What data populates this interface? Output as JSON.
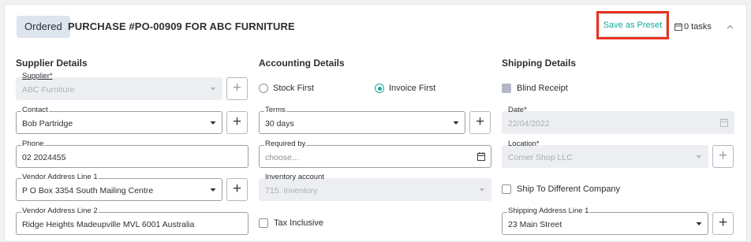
{
  "header": {
    "status_badge": "Ordered",
    "title": "PURCHASE #PO-00909 FOR ABC FURNITURE",
    "save_preset_label": "Save as Preset",
    "tasks_label": "0 tasks"
  },
  "supplier": {
    "heading": "Supplier Details",
    "supplier_label": "Supplier*",
    "supplier_value": "ABC Furniture",
    "contact_label": "Contact",
    "contact_value": "Bob Partridge",
    "phone_label": "Phone",
    "phone_value": "02 2024455",
    "address1_label": "Vendor Address Line 1",
    "address1_value": "P O Box 3354 South Mailing Centre",
    "address2_label": "Vendor Address Line 2",
    "address2_value": "Ridge Heights Madeupville MVL 6001 Australia"
  },
  "accounting": {
    "heading": "Accounting Details",
    "radio_stock_first": "Stock First",
    "radio_invoice_first": "Invoice First",
    "selected": "Invoice First",
    "terms_label": "Terms",
    "terms_value": "30 days",
    "required_by_label": "Required by",
    "required_by_placeholder": "choose...",
    "inventory_label": "Inventory account",
    "inventory_value": "715: Inventory",
    "tax_inclusive_label": "Tax Inclusive",
    "tax_inclusive_checked": false
  },
  "shipping": {
    "heading": "Shipping Details",
    "blind_receipt_label": "Blind Receipt",
    "blind_receipt_checked": false,
    "date_label": "Date*",
    "date_value": "22/04/2022",
    "location_label": "Location*",
    "location_value": "Corner Shop LLC",
    "ship_different_label": "Ship To Different Company",
    "ship_different_checked": false,
    "address1_label": "Shipping Address Line 1",
    "address1_value": "23 Main Street"
  },
  "colors": {
    "accent": "#17a89a",
    "highlight": "#e8321e",
    "badge_bg": "#dde4ee"
  }
}
